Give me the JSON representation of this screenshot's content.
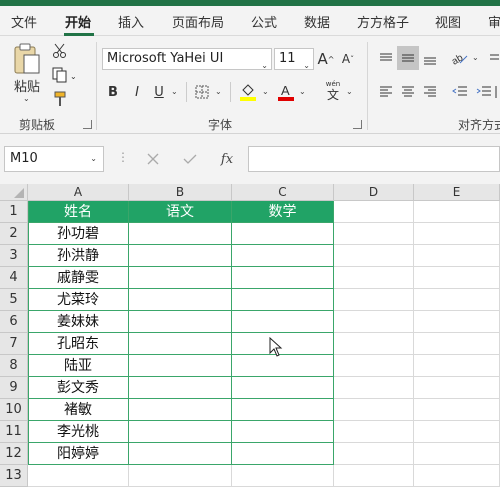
{
  "tabs": [
    {
      "label": "文件",
      "active": false
    },
    {
      "label": "开始",
      "active": true
    },
    {
      "label": "插入",
      "active": false
    },
    {
      "label": "页面布局",
      "active": false
    },
    {
      "label": "公式",
      "active": false
    },
    {
      "label": "数据",
      "active": false
    },
    {
      "label": "方方格子",
      "active": false
    },
    {
      "label": "视图",
      "active": false
    },
    {
      "label": "审",
      "active": false
    }
  ],
  "ribbon": {
    "clipboard": {
      "paste_label": "粘贴",
      "group_label": "剪贴板"
    },
    "font": {
      "font_name": "Microsoft YaHei UI",
      "font_size": "11",
      "group_label": "字体",
      "bold": "B",
      "italic": "I",
      "underline": "U",
      "wen_label": "wén",
      "wen_char": "文",
      "increase_glyph": "A",
      "decrease_glyph": "A"
    },
    "alignment": {
      "group_label": "对齐方式"
    }
  },
  "formula_bar": {
    "name_box": "M10",
    "formula": "",
    "fx_label": "fx"
  },
  "columns": [
    "A",
    "B",
    "C",
    "D",
    "E"
  ],
  "rows": [
    "1",
    "2",
    "3",
    "4",
    "5",
    "6",
    "7",
    "8",
    "9",
    "10",
    "11",
    "12",
    "13"
  ],
  "table": {
    "headers": [
      "姓名",
      "语文",
      "数学"
    ],
    "names": [
      "孙功碧",
      "孙洪静",
      "戚静雯",
      "尤菜玲",
      "姜妹妹",
      "孔昭东",
      "陆亚",
      "彭文秀",
      "褚敏",
      "李光桃",
      "阳婷婷"
    ]
  },
  "colors": {
    "accent": "#217346",
    "header_fill": "#21a366",
    "table_border": "#3aa66a"
  }
}
